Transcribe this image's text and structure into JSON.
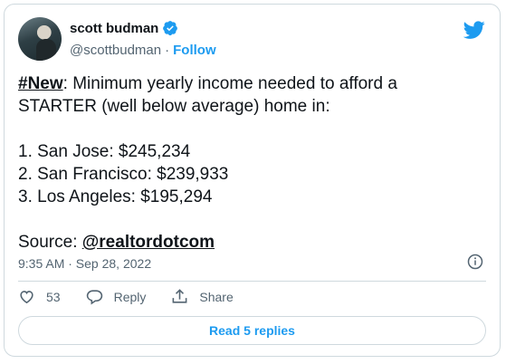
{
  "author": {
    "name": "scott budman",
    "handle": "@scottbudman",
    "separator": "·",
    "follow_label": "Follow"
  },
  "tweet": {
    "hashtag": "#New",
    "line1_rest": ": Minimum yearly income needed to afford a",
    "line2": "STARTER (well below average) home in:",
    "items": [
      "1. San Jose: $245,234",
      "2. San Francisco: $239,933",
      "3. Los Angeles: $195,294"
    ],
    "source_label": "Source: ",
    "source_mention": "@realtordotcom"
  },
  "timestamp": "9:35 AM · Sep 28, 2022",
  "actions": {
    "like_count": "53",
    "reply_label": "Reply",
    "share_label": "Share"
  },
  "read_replies_label": "Read 5 replies",
  "colors": {
    "accent": "#1d9bf0",
    "text": "#0f1419",
    "muted": "#536471",
    "border": "#cfd9de"
  }
}
